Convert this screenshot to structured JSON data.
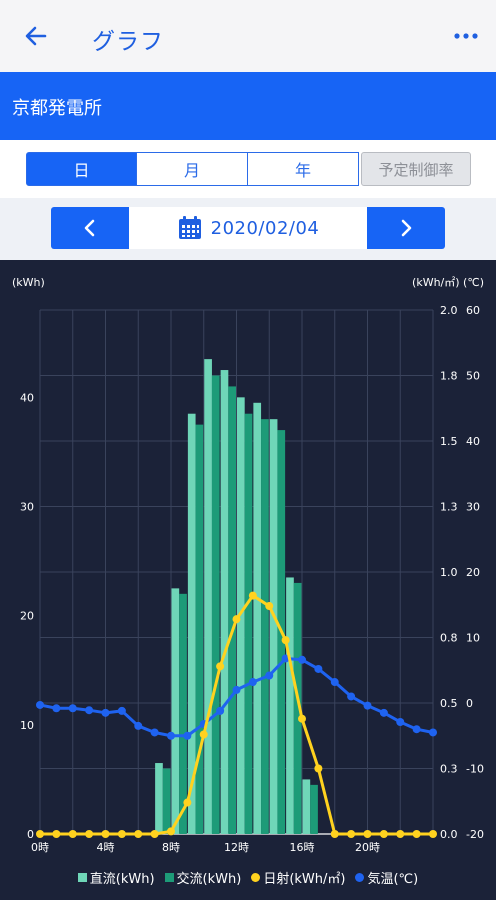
{
  "appbar": {
    "title": "グラフ",
    "back_icon": "arrow-left-icon",
    "more_icon": "more-dots-icon"
  },
  "plant": {
    "name": "京都発電所"
  },
  "tabs": [
    {
      "label": "日",
      "active": true
    },
    {
      "label": "月",
      "active": false
    },
    {
      "label": "年",
      "active": false
    },
    {
      "label": "予定制御率",
      "disabled": true
    }
  ],
  "date_nav": {
    "date": "2020/02/04",
    "calendar_icon": "calendar-icon"
  },
  "colors": {
    "accent": "#1764f5",
    "dc": "#6fd6b8",
    "ac": "#1d9b78",
    "irr": "#ffd21f",
    "temp": "#1f63f0",
    "bg": "#1b2238"
  },
  "chart_data": {
    "type": "bar",
    "left_unit": "(kWh)",
    "right_unit": "(kWh/㎡) (℃)",
    "left_ticks": [
      "0",
      "10",
      "20",
      "30",
      "40"
    ],
    "right_ticks": [
      {
        "irr": "0.0",
        "temp": "-20"
      },
      {
        "irr": "0.3",
        "temp": "-10"
      },
      {
        "irr": "0.5",
        "temp": "0"
      },
      {
        "irr": "0.8",
        "temp": "10"
      },
      {
        "irr": "1.0",
        "temp": "20"
      },
      {
        "irr": "1.3",
        "temp": "30"
      },
      {
        "irr": "1.5",
        "temp": "40"
      },
      {
        "irr": "1.8",
        "temp": "50"
      },
      {
        "irr": "2.0",
        "temp": "60"
      }
    ],
    "x_ticks": [
      "0時",
      "4時",
      "8時",
      "12時",
      "16時",
      "20時"
    ],
    "hours": [
      0,
      1,
      2,
      3,
      4,
      5,
      6,
      7,
      8,
      9,
      10,
      11,
      12,
      13,
      14,
      15,
      16,
      17,
      18,
      19,
      20,
      21,
      22,
      23
    ],
    "series": [
      {
        "name": "直流(kWh)",
        "kind": "bar",
        "values": [
          0,
          0,
          0,
          0,
          0,
          0,
          0,
          6.5,
          22.5,
          38.5,
          43.5,
          42.5,
          40,
          39.5,
          38,
          23.5,
          5,
          0,
          0,
          0,
          0,
          0,
          0,
          0
        ]
      },
      {
        "name": "交流(kWh)",
        "kind": "bar",
        "values": [
          0,
          0,
          0,
          0,
          0,
          0,
          0,
          6,
          22,
          37.5,
          42,
          41,
          38.5,
          38,
          37,
          23,
          4.5,
          0,
          0,
          0,
          0,
          0,
          0,
          0
        ]
      },
      {
        "name": "日射(kWh/㎡)",
        "kind": "line",
        "axis": "irr",
        "values": [
          0,
          0,
          0,
          0,
          0,
          0,
          0,
          0,
          0.01,
          0.12,
          0.38,
          0.64,
          0.82,
          0.91,
          0.87,
          0.74,
          0.44,
          0.25,
          0,
          0,
          0,
          0,
          0,
          0,
          0
        ]
      },
      {
        "name": "気温(℃)",
        "kind": "line",
        "axis": "temp",
        "values": [
          -0.3,
          -0.8,
          -0.8,
          -1.1,
          -1.5,
          -1.2,
          -3.5,
          -4.5,
          -5,
          -5,
          -3.2,
          -1.2,
          2.0,
          3.2,
          4.2,
          6.8,
          6.6,
          5.2,
          3.2,
          1.0,
          -0.4,
          -1.5,
          -2.9,
          -4,
          -4.5
        ]
      }
    ],
    "ylim_left": [
      0,
      48
    ],
    "ylim_irr": [
      0,
      2.0
    ],
    "ylim_temp": [
      -20,
      60
    ],
    "grid": true,
    "legend_position": "bottom"
  }
}
